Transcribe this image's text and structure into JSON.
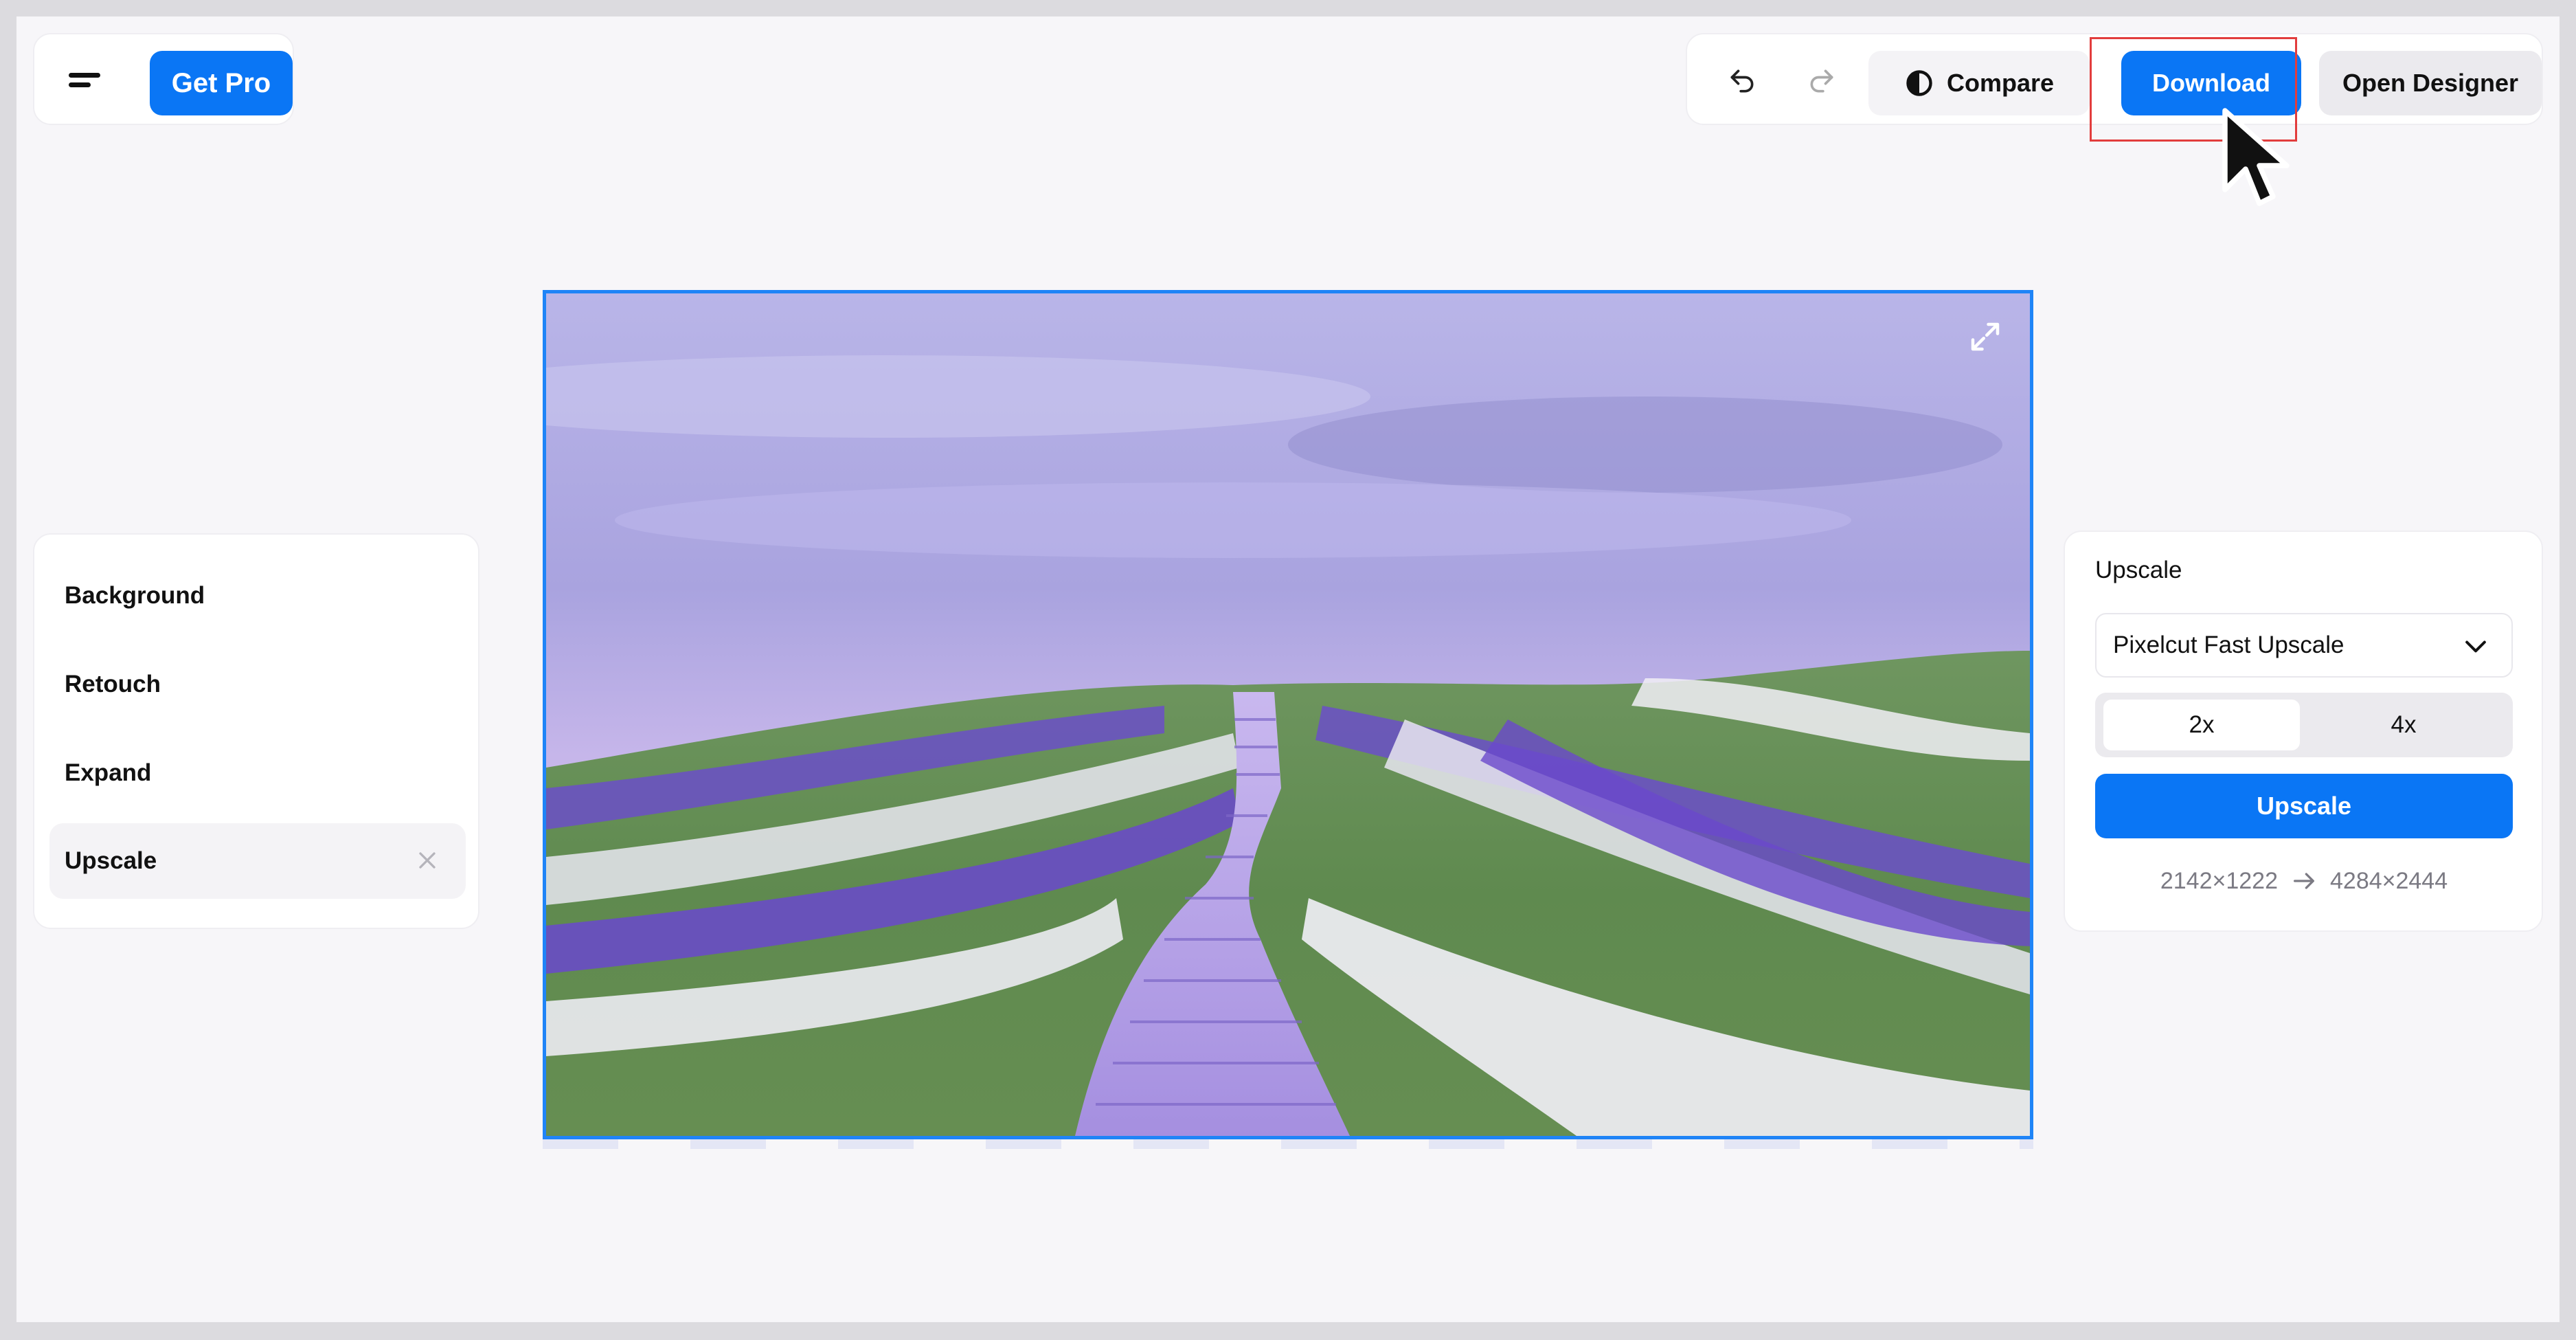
{
  "header": {
    "get_pro_label": "Get Pro",
    "compare_label": "Compare",
    "download_label": "Download",
    "open_designer_label": "Open Designer"
  },
  "tools": {
    "items": [
      {
        "label": "Background"
      },
      {
        "label": "Retouch"
      },
      {
        "label": "Expand"
      },
      {
        "label": "Upscale"
      }
    ],
    "active": "Upscale"
  },
  "upscale_panel": {
    "title": "Upscale",
    "model_selected": "Pixelcut Fast Upscale",
    "scale_options": [
      "2x",
      "4x"
    ],
    "scale_selected": "2x",
    "button_label": "Upscale",
    "from_size": "2142×1222",
    "to_size": "4284×2444"
  },
  "colors": {
    "accent": "#0a76f5",
    "selection_border": "#1f84f7",
    "highlight": "#e23d3d"
  },
  "icons": {
    "menu": "menu-icon",
    "undo": "undo-icon",
    "redo": "redo-icon",
    "compare": "compare-icon",
    "expand": "expand-icon",
    "close": "close-icon",
    "chevron": "chevron-down-icon",
    "arrow": "arrow-right-icon",
    "cursor": "mouse-cursor-icon"
  }
}
